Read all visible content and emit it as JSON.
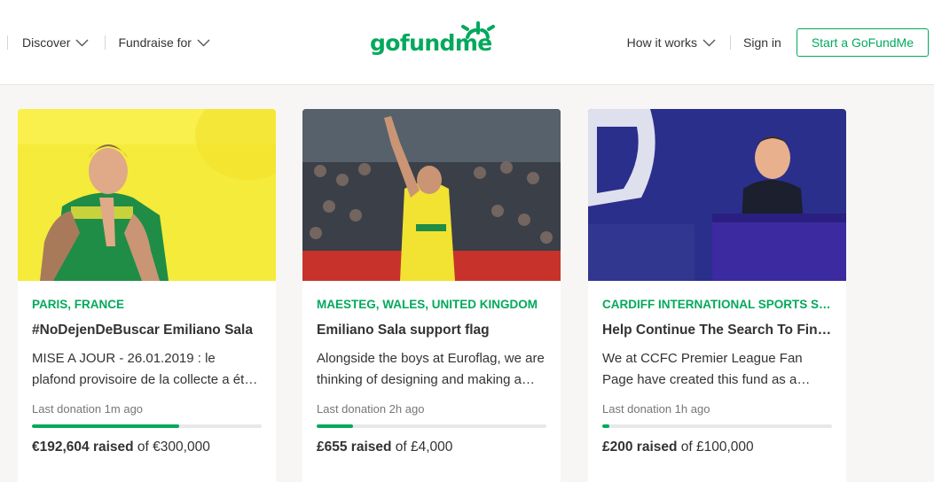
{
  "header": {
    "nav_left": [
      {
        "label": "Discover"
      },
      {
        "label": "Fundraise for"
      }
    ],
    "logo_text": "gofundme",
    "how_it_works": "How it works",
    "sign_in": "Sign in",
    "start_button": "Start a GoFundMe"
  },
  "colors": {
    "brand_green": "#02a95c",
    "background": "#f8f6f4"
  },
  "cards": [
    {
      "location": "PARIS, FRANCE",
      "title": "#NoDejenDeBuscar Emiliano Sala",
      "description": "MISE A JOUR - 26.01.2019 : le plafond provisoire de la collecte a été augmenté",
      "last_donation": "Last donation 1m ago",
      "progress_fraction": 0.64,
      "raised_amount": "€192,604 raised",
      "goal_text": " of €300,000"
    },
    {
      "location": "MAESTEG, WALES, UNITED KINGDOM",
      "title": "Emiliano Sala support flag",
      "description": "Alongside the boys at Euroflag, we are thinking of designing and making a flag",
      "last_donation": "Last donation 2h ago",
      "progress_fraction": 0.16,
      "raised_amount": "£655 raised",
      "goal_text": " of £4,000"
    },
    {
      "location": "CARDIFF INTERNATIONAL SPORTS STADIUM",
      "title": "Help Continue The Search To Find Emiliano Sala",
      "description": "We at CCFC Premier League Fan Page have created this fund as a means to help",
      "last_donation": "Last donation 1h ago",
      "progress_fraction": 0.03,
      "raised_amount": "£200 raised",
      "goal_text": " of £100,000"
    }
  ]
}
